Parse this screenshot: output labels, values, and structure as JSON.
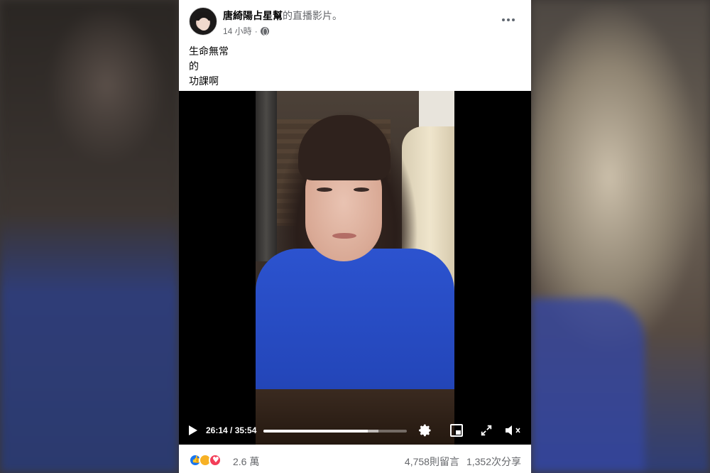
{
  "post": {
    "author_name": "唐綺陽占星幫",
    "author_suffix": "的直播影片。",
    "timestamp": "14 小時",
    "privacy_icon": "globe-icon",
    "more_icon": "more-dots-icon",
    "caption_lines": [
      "生命無常",
      "的",
      "功課啊"
    ]
  },
  "video": {
    "time_display": "26:14 / 35:54",
    "progress": 0.73,
    "buffered": 0.8,
    "controls": {
      "play": "play-icon",
      "settings": "gear-icon",
      "pip": "picture-in-picture-icon",
      "fullscreen": "fullscreen-icon",
      "volume": "volume-muted-icon"
    }
  },
  "footer": {
    "reactions_count": "2.6 萬",
    "comments": "4,758則留言",
    "shares": "1,352次分享",
    "reaction_icons": [
      "like-icon",
      "sad-icon",
      "love-icon"
    ],
    "colors": {
      "like": "#1877f2",
      "sad": "#f7b125",
      "love": "#f33e58"
    }
  }
}
